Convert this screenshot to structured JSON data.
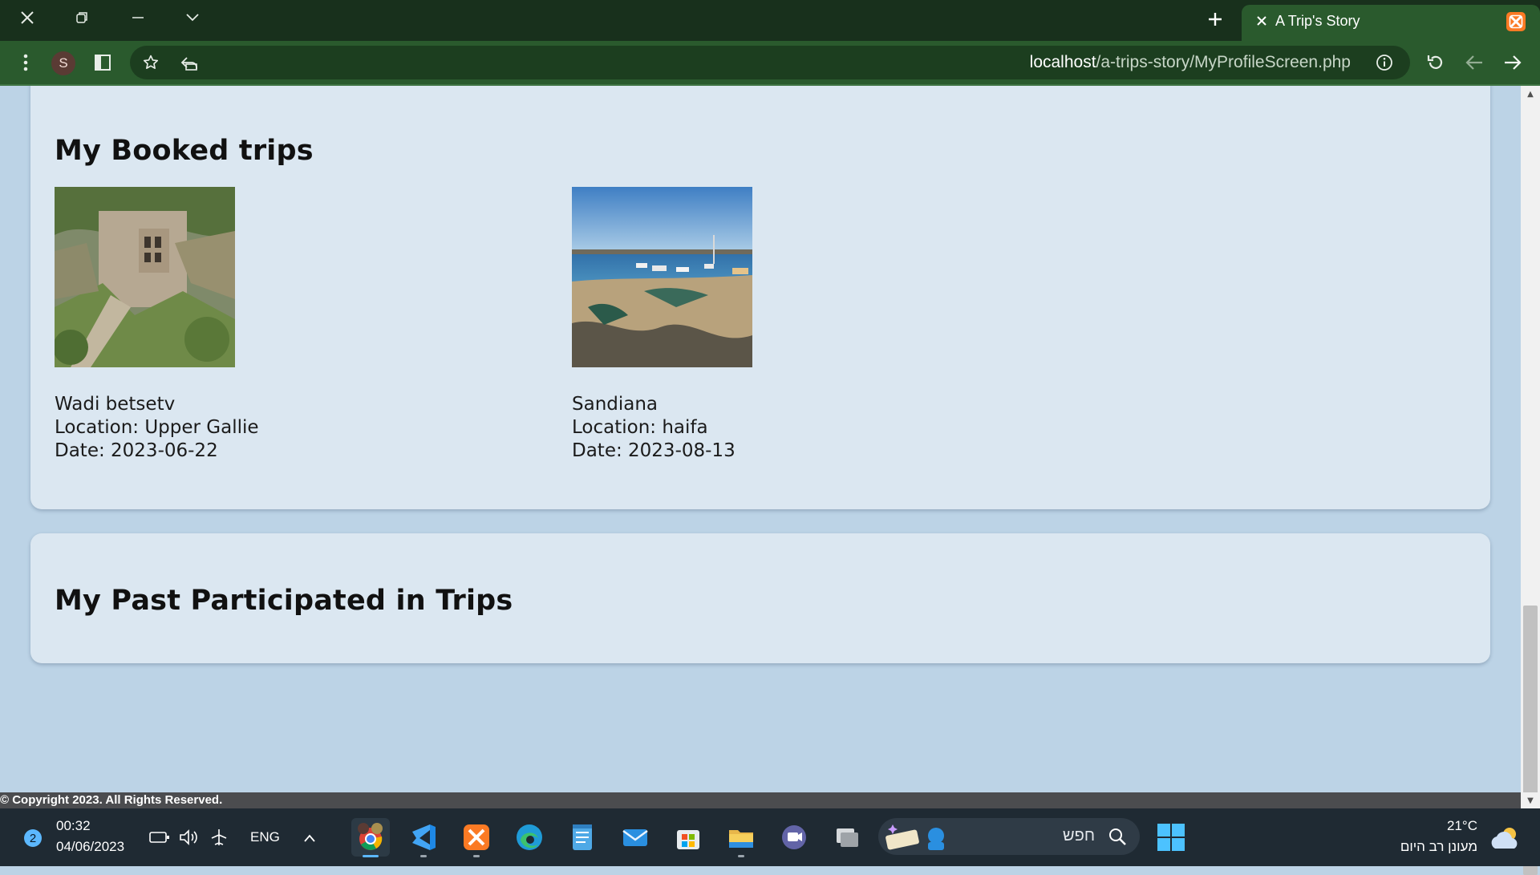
{
  "browser": {
    "tab_title": "A Trip's Story",
    "url_host": "localhost",
    "url_path": "/a-trips-story/MyProfileScreen.php",
    "profile_initial": "S"
  },
  "booked": {
    "heading": "My Booked trips",
    "trips": [
      {
        "name": "Wadi betsetv",
        "location": "Location: Upper Gallie",
        "date": "Date: 2023-06-22"
      },
      {
        "name": "Sandiana",
        "location": "Location: haifa",
        "date": "Date: 2023-08-13"
      }
    ]
  },
  "past": {
    "heading": "My Past Participated in Trips"
  },
  "footer": {
    "text": "© Copyright 2023. All Rights Reserved."
  },
  "taskbar": {
    "notification_count": "2",
    "time": "00:32",
    "date": "04/06/2023",
    "language": "ENG",
    "search_placeholder": "חפש",
    "temperature": "21°C",
    "weather": "מעונן רב היום"
  },
  "colors": {
    "chrome_dark": "#18301c",
    "chrome_toolbar": "#2a5a2d",
    "page_bg": "#bcd3e6",
    "card_bg": "#dbe7f1",
    "taskbar_bg": "#1f2a33"
  }
}
